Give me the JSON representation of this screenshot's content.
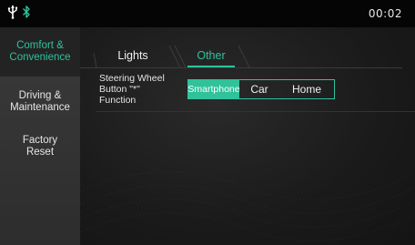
{
  "status_bar": {
    "icons": [
      "usb-icon",
      "bluetooth-icon"
    ],
    "clock": "00:02"
  },
  "sidebar": {
    "items": [
      {
        "label": "Comfort &\nConvenience",
        "active": true
      },
      {
        "label": "Driving &\nMaintenance",
        "active": false
      },
      {
        "label": "Factory\nReset",
        "active": false
      }
    ]
  },
  "tabs": [
    {
      "label": "Lights",
      "active": false
    },
    {
      "label": "Other",
      "active": true
    }
  ],
  "settings": {
    "steering_button": {
      "label": "Steering Wheel\nButton \"*\"\nFunction",
      "options": [
        "Smartphone",
        "Car",
        "Home"
      ],
      "selected": "Smartphone"
    }
  },
  "colors": {
    "accent": "#2fc29b",
    "background": "#1b1b1b",
    "sidebar": "#333333"
  }
}
